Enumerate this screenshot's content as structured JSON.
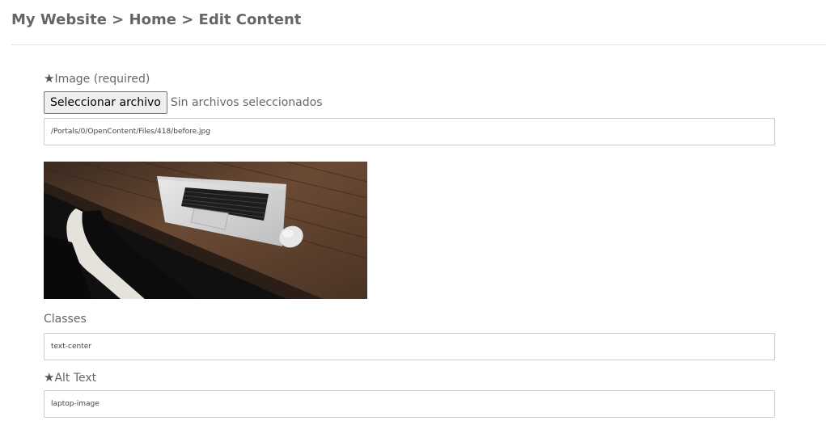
{
  "breadcrumb": "My Website > Home > Edit Content",
  "image_field": {
    "required_marker": "★",
    "label": "Image (required)",
    "choose_button": "Seleccionar archivo",
    "file_status": "Sin archivos seleccionados",
    "path_value": "/Portals/0/OpenContent/Files/418/before.jpg"
  },
  "classes_field": {
    "label": "Classes",
    "value": "text-center"
  },
  "alt_field": {
    "required_marker": "★",
    "label": "Alt Text",
    "value": "laptop-image"
  }
}
